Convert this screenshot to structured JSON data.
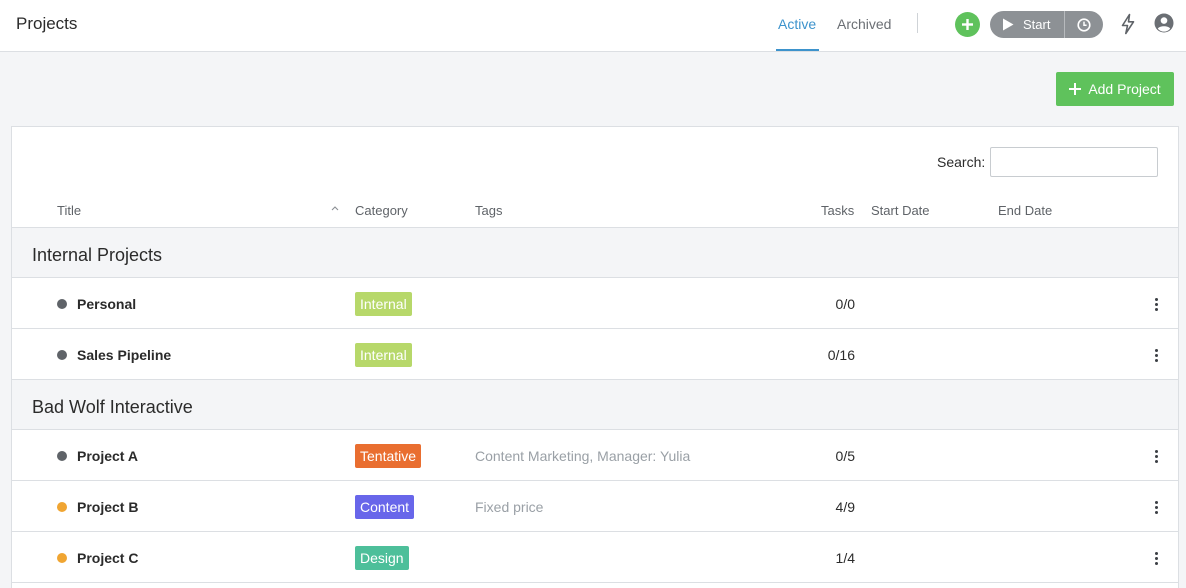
{
  "header": {
    "title": "Projects",
    "tabs": [
      {
        "label": "Active",
        "active": true
      },
      {
        "label": "Archived",
        "active": false
      }
    ],
    "timer_label": "Start",
    "icons": [
      "plus-icon",
      "play-icon",
      "clock-icon",
      "bolt-icon",
      "user-icon"
    ]
  },
  "toolbar": {
    "add_project_label": "Add Project"
  },
  "search": {
    "label": "Search:",
    "value": ""
  },
  "table": {
    "columns": {
      "title": "Title",
      "category": "Category",
      "tags": "Tags",
      "tasks": "Tasks",
      "start_date": "Start Date",
      "end_date": "End Date"
    },
    "groups": [
      {
        "name": "Internal Projects",
        "rows": [
          {
            "title": "Personal",
            "dot_color": "#5f6368",
            "category": "Internal",
            "category_color": "#b7d86a",
            "tags": "",
            "tasks": "0/0"
          },
          {
            "title": "Sales Pipeline",
            "dot_color": "#5f6368",
            "category": "Internal",
            "category_color": "#b7d86a",
            "tags": "",
            "tasks": "0/16"
          }
        ]
      },
      {
        "name": "Bad Wolf Interactive",
        "rows": [
          {
            "title": "Project A",
            "dot_color": "#5f6368",
            "category": "Tentative",
            "category_color": "#e96e30",
            "tags": "Content Marketing, Manager: Yulia",
            "tasks": "0/5"
          },
          {
            "title": "Project B",
            "dot_color": "#f0a532",
            "category": "Content",
            "category_color": "#6866ea",
            "tags": "Fixed price",
            "tasks": "4/9"
          },
          {
            "title": "Project C",
            "dot_color": "#f0a532",
            "category": "Design",
            "category_color": "#4dbf9a",
            "tags": "",
            "tasks": "1/4"
          }
        ]
      }
    ]
  },
  "colors": {
    "accent": "#3d93cc",
    "success": "#5fc25c",
    "timer": "#8d9195"
  }
}
